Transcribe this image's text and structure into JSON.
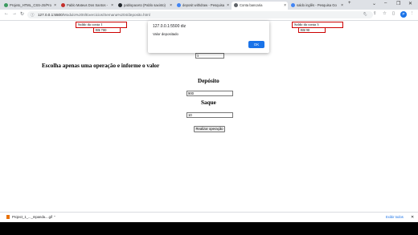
{
  "browser": {
    "tabs": [
      {
        "title": "Projeto_HTML_CSS-JS/Pro",
        "icon": "green-dot-icon"
      },
      {
        "title": "Pablo Mateus Dos Santos -",
        "icon": "github-icon"
      },
      {
        "title": "pablopaceto (Pablo saxinto)",
        "icon": "github-icon"
      },
      {
        "title": "deposit withdraw - Pesquisa",
        "icon": "google-icon"
      },
      {
        "title": "Conta bancaria",
        "icon": "globe-icon"
      },
      {
        "title": "saldo inglês - Pesquisa Go",
        "icon": "google-icon"
      }
    ],
    "address_host": "127.0.0.1:5500",
    "address_path": "/Modulo%20II/Exercicios/Semana%204/deposito.html",
    "profile_initial": "P"
  },
  "page": {
    "balance1_label": "Saldo da conta 1",
    "balance1_value": "R$ 700",
    "balance3_label": "Saldo da conta 3",
    "balance3_value": "R$ 90",
    "account_input_value": "3",
    "instruction": "Escolha apenas uma operação e informe o valor",
    "deposit_title": "Depósito",
    "deposit_value": "900",
    "withdraw_title": "Saque",
    "withdraw_value": "10",
    "submit_label": "Realizar operação"
  },
  "dialog": {
    "origin": "127.0.0.1:5500 diz",
    "message": "Valor depositado",
    "ok_label": "OK"
  },
  "downloads": {
    "file_name": "Project_1_..._mpanda....gif",
    "show_all": "Exibir todos"
  }
}
